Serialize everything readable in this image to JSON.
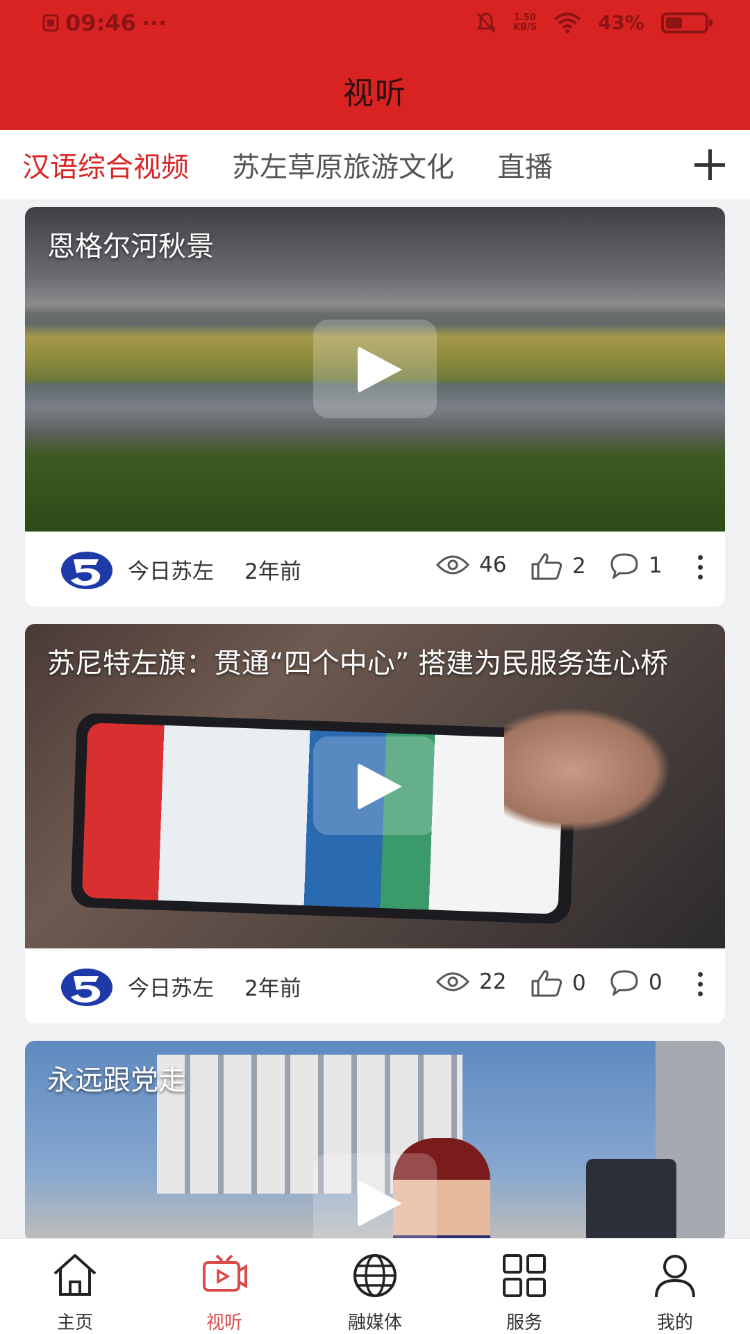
{
  "status_bar": {
    "time": "09:46",
    "dots": "···",
    "net_speed_value": "1.50",
    "net_speed_unit": "KB/S",
    "battery_percent": "43%",
    "battery_level": 0.43
  },
  "header": {
    "title": "视听"
  },
  "tabs": [
    {
      "label": "汉语综合视频",
      "active": true
    },
    {
      "label": "苏左草原旅游文化",
      "active": false
    },
    {
      "label": "直播",
      "active": false
    }
  ],
  "feed": [
    {
      "title": "恩格尔河秋景",
      "source": "今日苏左",
      "time": "2年前",
      "views": "46",
      "likes": "2",
      "comments": "1"
    },
    {
      "title": "苏尼特左旗：贯通“四个中心” 搭建为民服务连心桥",
      "source": "今日苏左",
      "time": "2年前",
      "views": "22",
      "likes": "0",
      "comments": "0"
    },
    {
      "title": "永远跟党走"
    }
  ],
  "bottom_nav": [
    {
      "label": "主页",
      "icon": "home-icon"
    },
    {
      "label": "视听",
      "icon": "tv-icon",
      "active": true
    },
    {
      "label": "融媒体",
      "icon": "globe-icon"
    },
    {
      "label": "服务",
      "icon": "grid-icon"
    },
    {
      "label": "我的",
      "icon": "user-icon"
    }
  ],
  "colors": {
    "brand_red": "#d92323",
    "active_nav": "#d94a4a"
  }
}
